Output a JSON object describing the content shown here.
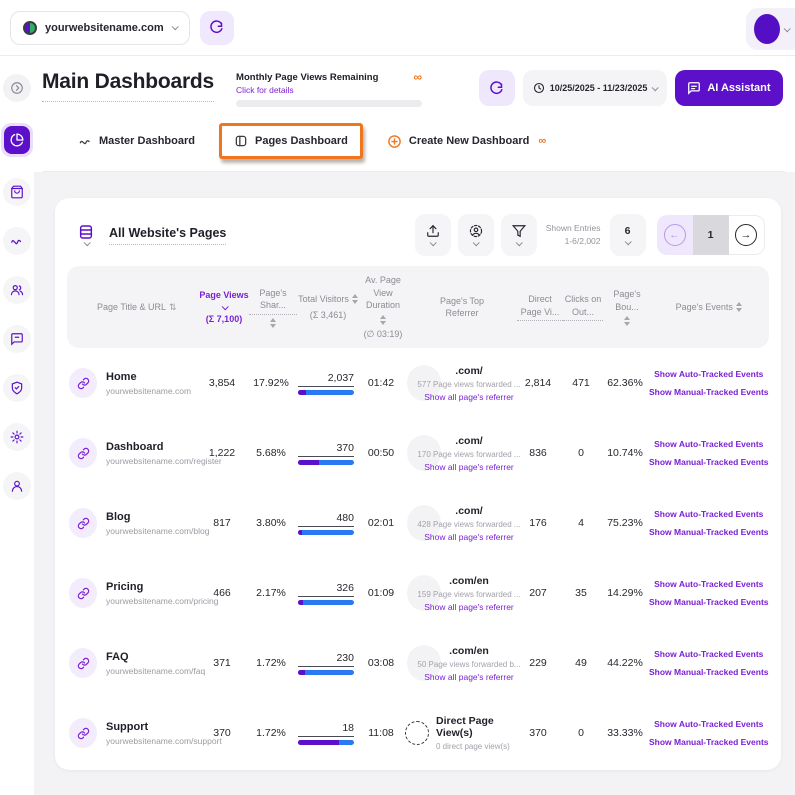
{
  "colors": {
    "accent": "#5c10c9",
    "link_purple": "#7a1fd4",
    "orange": "#f0751f",
    "bar_blue": "#2979f2",
    "bar_purple": "#5c10c9"
  },
  "topbar": {
    "website": "yourwebsitename.com"
  },
  "header": {
    "title": "Main Dashboards",
    "quota_label": "Monthly Page Views Remaining",
    "quota_link": "Click for details",
    "quota_value": "∞",
    "date_range": "10/25/2025 - 11/23/2025",
    "ai_button": "AI Assistant"
  },
  "tabs": {
    "master": "Master Dashboard",
    "pages": "Pages Dashboard",
    "create": "Create New Dashboard",
    "create_badge": "∞"
  },
  "sidebar": {
    "items": [
      "collapse",
      "dashboards",
      "store",
      "traffic",
      "visitors",
      "feedback",
      "privacy",
      "settings",
      "account"
    ],
    "active": "dashboards"
  },
  "table": {
    "title": "All Website's Pages",
    "shown_entries_label": "Shown Entries",
    "shown_entries_value": "1-6/2,002",
    "page_size": "6",
    "current_page": "1",
    "events_links": [
      "Show Auto-Tracked Events",
      "Show Manual-Tracked Events"
    ],
    "columns": [
      {
        "label": "Page Title & URL"
      },
      {
        "label": "Page Views",
        "sub": "(Σ 7,100)"
      },
      {
        "label": "Page's Shar..."
      },
      {
        "label": "Total Visitors",
        "sub": "(Σ 3,461)"
      },
      {
        "label": "Av. Page View Duration",
        "sub": "(∅ 03:19)"
      },
      {
        "label": "Page's Top Referrer"
      },
      {
        "label": "Direct Page Vi..."
      },
      {
        "label": "Clicks on Out..."
      },
      {
        "label": "Page's Bou..."
      },
      {
        "label": "Page's Events"
      }
    ],
    "rows": [
      {
        "title": "Home",
        "url": "yourwebsitename.com",
        "views": "3,854",
        "share": "17.92%",
        "visitors": "2,037",
        "bar_purple_pct": 14,
        "duration": "01:42",
        "referrer": {
          "name": ".com/",
          "note": "577 Page views forwarded ...",
          "link": "Show all page's referrer"
        },
        "direct": "2,814",
        "clicks": "471",
        "bounce": "62.36%"
      },
      {
        "title": "Dashboard",
        "url": "yourwebsitename.com/register",
        "views": "1,222",
        "share": "5.68%",
        "visitors": "370",
        "bar_purple_pct": 38,
        "duration": "00:50",
        "referrer": {
          "name": ".com/",
          "note": "170 Page views forwarded ...",
          "link": "Show all page's referrer"
        },
        "direct": "836",
        "clicks": "0",
        "bounce": "10.74%"
      },
      {
        "title": "Blog",
        "url": "yourwebsitename.com/blog",
        "views": "817",
        "share": "3.80%",
        "visitors": "480",
        "bar_purple_pct": 7,
        "duration": "02:01",
        "referrer": {
          "name": ".com/",
          "note": "428 Page views forwarded ...",
          "link": "Show all page's referrer"
        },
        "direct": "176",
        "clicks": "4",
        "bounce": "75.23%"
      },
      {
        "title": "Pricing",
        "url": "yourwebsitename.com/pricing",
        "views": "466",
        "share": "2.17%",
        "visitors": "326",
        "bar_purple_pct": 9,
        "duration": "01:09",
        "referrer": {
          "name": ".com/en",
          "note": "159 Page views forwarded ...",
          "link": "Show all page's referrer"
        },
        "direct": "207",
        "clicks": "35",
        "bounce": "14.29%"
      },
      {
        "title": "FAQ",
        "url": "yourwebsitename.com/faq",
        "views": "371",
        "share": "1.72%",
        "visitors": "230",
        "bar_purple_pct": 13,
        "duration": "03:08",
        "referrer": {
          "name": ".com/en",
          "note": "50 Page views forwarded b...",
          "link": "Show all page's referrer"
        },
        "direct": "229",
        "clicks": "49",
        "bounce": "44.22%"
      },
      {
        "title": "Support",
        "url": "yourwebsitename.com/support",
        "views": "370",
        "share": "1.72%",
        "visitors": "18",
        "bar_purple_pct": 74,
        "duration": "11:08",
        "referrer": {
          "name": "Direct Page View(s)",
          "note": "0 direct page view(s)",
          "is_direct": true
        },
        "direct": "370",
        "clicks": "0",
        "bounce": "33.33%"
      }
    ]
  }
}
